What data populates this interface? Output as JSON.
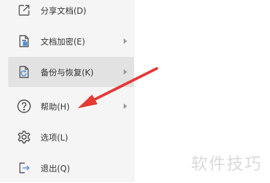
{
  "menu": {
    "items": [
      {
        "label": "分享文档(D)",
        "icon": "share-icon",
        "has_submenu": false,
        "active": false
      },
      {
        "label": "文档加密(E)",
        "icon": "document-lock-icon",
        "has_submenu": true,
        "active": false
      },
      {
        "label": "备份与恢复(K)",
        "icon": "backup-restore-icon",
        "has_submenu": true,
        "active": true
      },
      {
        "label": "帮助(H)",
        "icon": "help-icon",
        "has_submenu": true,
        "active": false
      },
      {
        "label": "选项(L)",
        "icon": "gear-icon",
        "has_submenu": false,
        "active": false
      },
      {
        "label": "退出(Q)",
        "icon": "exit-icon",
        "has_submenu": false,
        "active": false
      }
    ]
  },
  "annotation": {
    "color": "#e53935"
  },
  "watermark": {
    "text": "软件技巧"
  }
}
